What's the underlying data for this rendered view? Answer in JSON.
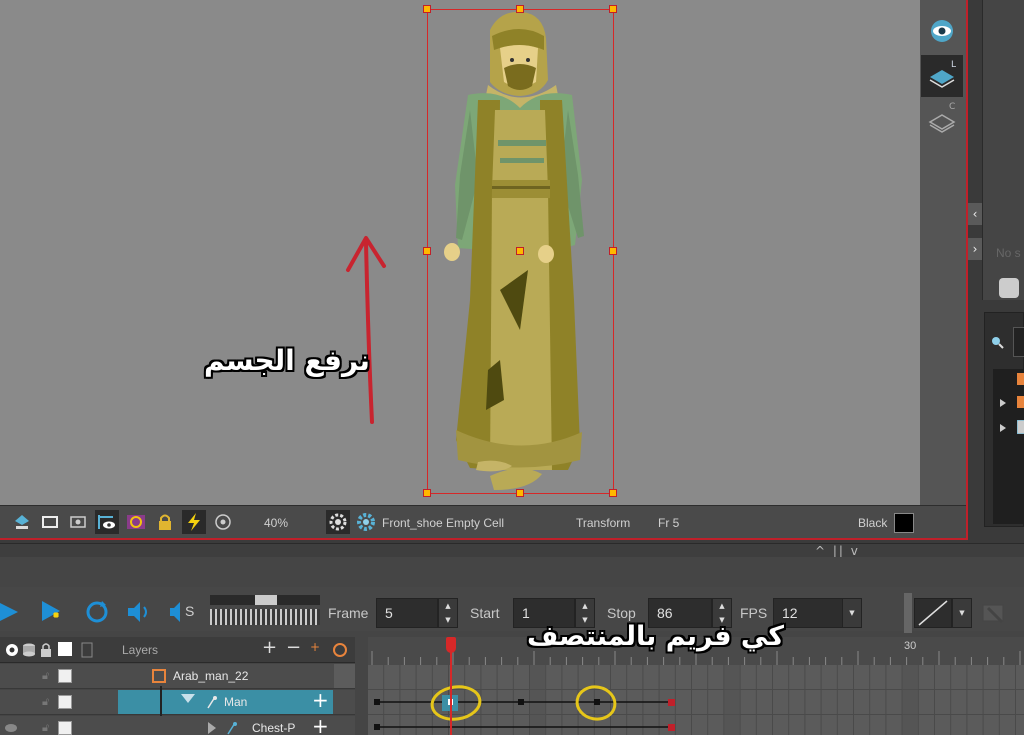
{
  "annotations": {
    "raise_body": "نرفع الجسم",
    "frame_middle": "كي فريم بالمنتصف"
  },
  "camera_toolbar": {
    "zoom": "40%",
    "drawing_info": "Front_shoe Empty Cell",
    "tool": "Transform",
    "frame": "Fr 5",
    "color_name": "Black"
  },
  "right_strip": {
    "letter_l": "L",
    "letter_c": "C"
  },
  "right_panel": {
    "hint_text": "No s"
  },
  "playback": {
    "frame_label": "Frame",
    "frame_value": "5",
    "start_label": "Start",
    "start_value": "1",
    "stop_label": "Stop",
    "stop_value": "86",
    "fps_label": "FPS",
    "fps_value": "12",
    "sound_label": "S"
  },
  "layers": {
    "header_label": "Layers",
    "rows": [
      {
        "name": "Arab_man_22"
      },
      {
        "name": "Man"
      },
      {
        "name": "Chest-P"
      }
    ]
  },
  "timeline": {
    "ruler_mark": "30",
    "current_frame": 5
  },
  "colors": {
    "selection": "#d62828",
    "handle": "#ffb800",
    "selected_layer": "#3b8fa5",
    "annotation_circle": "#e6c619",
    "playhead": "#d62828"
  }
}
